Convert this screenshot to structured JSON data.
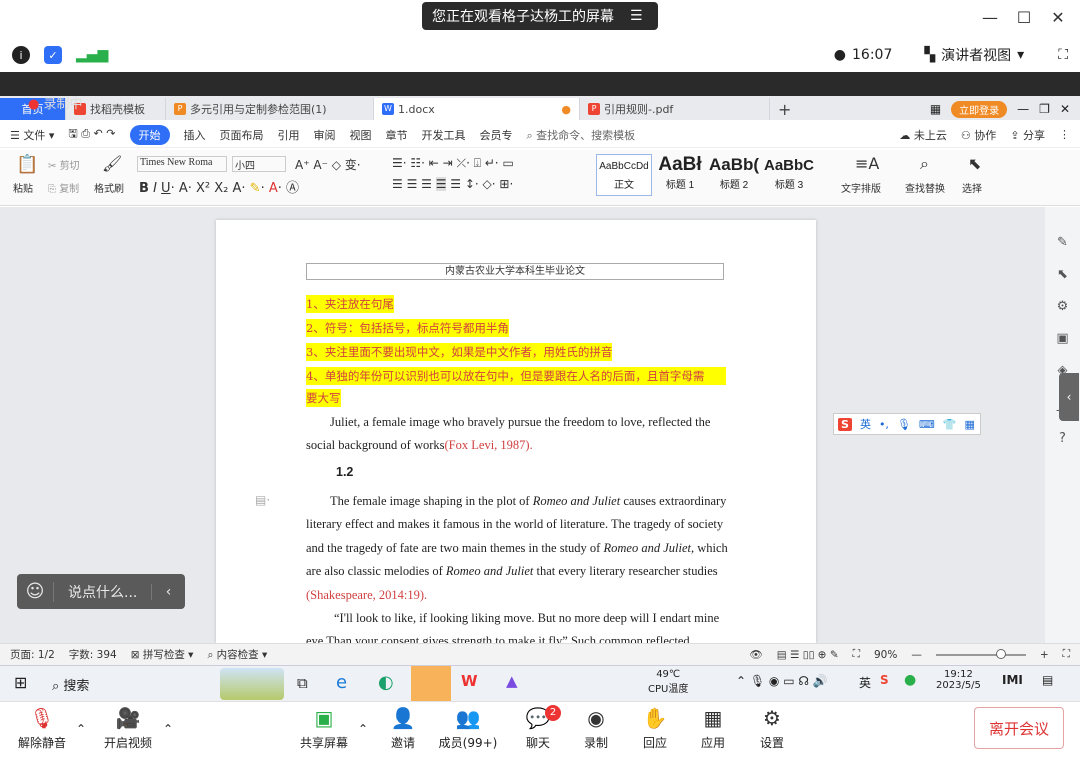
{
  "banner": {
    "title": "您正在观看格子达杨工的屏幕",
    "menu_icon": "list-icon"
  },
  "meeting_top": {
    "time": "16:07",
    "view_label": "演讲者视图"
  },
  "recording": "录制中",
  "tabs": [
    {
      "label": "首页"
    },
    {
      "label": "找稻壳模板"
    },
    {
      "label": "多元引用与定制参检范围(1)"
    },
    {
      "label": "1.docx"
    },
    {
      "label": "引用规则-.pdf"
    }
  ],
  "login_button": "立即登录",
  "menu": {
    "file": "文件",
    "items": [
      "开始",
      "插入",
      "页面布局",
      "引用",
      "审阅",
      "视图",
      "章节",
      "开发工具",
      "会员专"
    ],
    "search": "查找命令、搜索模板",
    "cloud": "未上云",
    "collab": "协作",
    "share": "分享"
  },
  "ribbon": {
    "paste": "粘贴",
    "cut": "剪切",
    "copy": "复制",
    "format_painter": "格式刷",
    "font_name": "Times New Roma",
    "font_size": "小四",
    "styles": [
      {
        "preview": "AaBbCcDd",
        "name": "正文"
      },
      {
        "preview": "AaBł",
        "name": "标题 1"
      },
      {
        "preview": "AaBb(",
        "name": "标题 2"
      },
      {
        "preview": "AaBbC",
        "name": "标题 3"
      }
    ],
    "text_layout": "文字排版",
    "find_replace": "查找替换",
    "select": "选择"
  },
  "doc": {
    "header": "内蒙古农业大学本科生毕业论文",
    "highlights": [
      "1、夹注放在句尾",
      "2、符号：包括括号，标点符号都用半角",
      "3、夹注里面不要出现中文，如果是中文作者，用姓氏的拼音",
      "4、单独的年份可以识别也可以放在句中，但是要跟在人名的后面，且首字母需",
      "要大写"
    ],
    "p1a": "Juliet, a female image who bravely pursue the freedom to love, reflected the",
    "p1b": "social background of works",
    "p1_cite": "(Fox Levi, 1987).",
    "heading": "1.2",
    "p2a": "The female image shaping in the plot of",
    "p2_italic": "Romeo and Juliet",
    "p2a2": "causes extraordinary",
    "p2b": "literary effect and makes it famous in the world of literature. The tragedy of society",
    "p2c": "and the tragedy of fate are two main themes in the study of",
    "p2c_italic": "Romeo and Juliet,",
    "p2c2": "which",
    "p2d": "are also classic melodies of",
    "p2d_italic": "Romeo and Juliet",
    "p2d2": "that every literary researcher studies",
    "p2_cite": "(Shakespeare, 2014:19).",
    "p3a": "“I'll look to like, if looking liking move. But no more deep will I endart mine",
    "p3b": "eye  Than your consent gives strength to make it fly”  Such common reflected"
  },
  "ime": {
    "lang": "英"
  },
  "status": {
    "page": "页面: 1/2",
    "words": "字数: 394",
    "spell": "拼写检查",
    "content": "内容检查",
    "zoom": "90%"
  },
  "chat": {
    "placeholder": "说点什么..."
  },
  "taskbar": {
    "search": "搜索",
    "temp": "49℃",
    "cpu": "CPU温度",
    "ime": "英",
    "time": "19:12",
    "date": "2023/5/5"
  },
  "meeting": {
    "mute": "解除静音",
    "video": "开启视频",
    "share": "共享屏幕",
    "invite": "邀请",
    "members": "成员(99+)",
    "chat": "聊天",
    "chat_badge": "2",
    "record": "录制",
    "replay": "回应",
    "apps": "应用",
    "settings": "设置",
    "leave": "离开会议"
  },
  "colors": {
    "accent": "#2f6ef6",
    "highlight": "#ffff00",
    "cite": "#d04040",
    "leave": "#dd3333"
  }
}
